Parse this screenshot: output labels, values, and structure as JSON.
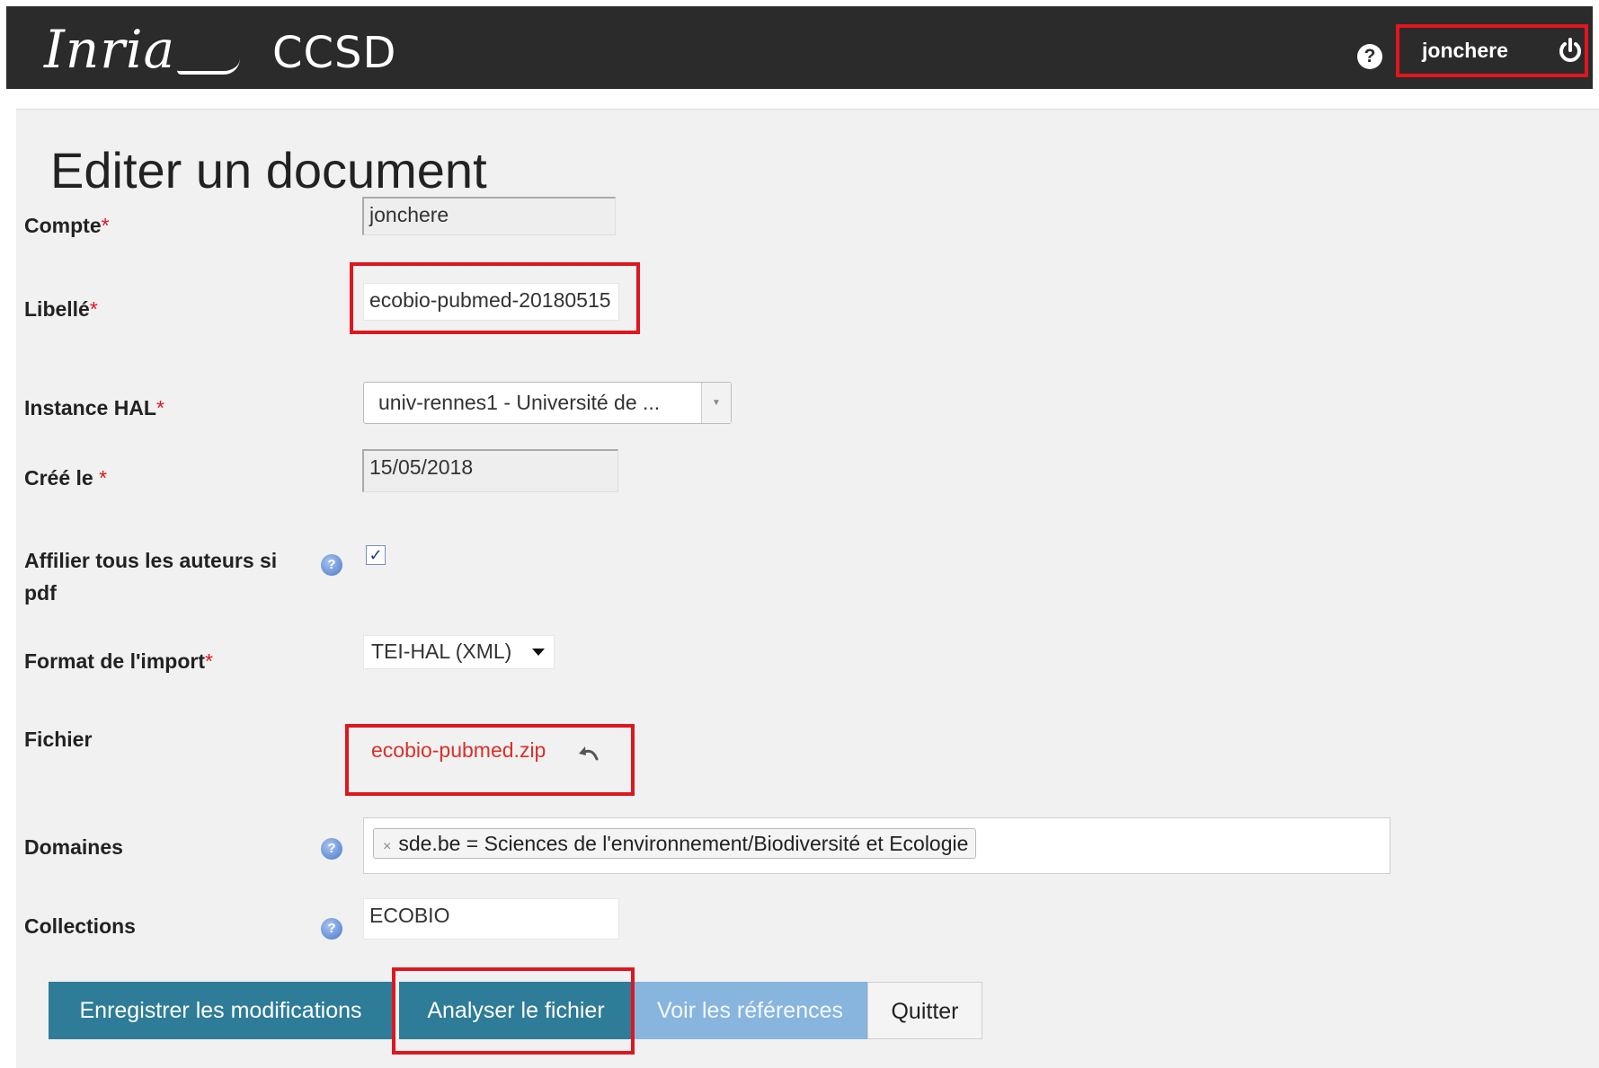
{
  "header": {
    "logo_inria": "Inria",
    "logo_ccsd": "CCSD",
    "username": "jonchere",
    "help_icon": "question-circle-icon",
    "logout_icon": "power-icon"
  },
  "page": {
    "title": "Editer un document"
  },
  "form": {
    "compte": {
      "label": "Compte",
      "required": "*",
      "value": "jonchere"
    },
    "libelle": {
      "label": "Libellé",
      "required": "*",
      "value": "ecobio-pubmed-20180515"
    },
    "instance": {
      "label": "Instance HAL",
      "required": "*",
      "value": "univ-rennes1 - Université de ..."
    },
    "cree_le": {
      "label": "Créé le ",
      "required": "*",
      "value": "15/05/2018"
    },
    "affilier": {
      "label_line1": "Affilier tous les auteurs si",
      "label_line2": "pdf",
      "checked": true,
      "check_mark": "✓"
    },
    "format": {
      "label": "Format de l'import",
      "required": "*",
      "value": "TEI-HAL (XML)"
    },
    "fichier": {
      "label": "Fichier",
      "file_name": "ecobio-pubmed.zip"
    },
    "domaines": {
      "label": "Domaines",
      "tag": "sde.be = Sciences de l'environnement/Biodiversité et Ecologie",
      "tag_remove": "×"
    },
    "collections": {
      "label": "Collections",
      "value": "ECOBIO"
    }
  },
  "buttons": {
    "save": "Enregistrer les modifications",
    "analyse": "Analyser le fichier",
    "view_refs": "Voir les références",
    "quit": "Quitter"
  },
  "colors": {
    "accent": "#2e7c97",
    "highlight": "#e0161e",
    "link": "#d9302a"
  }
}
